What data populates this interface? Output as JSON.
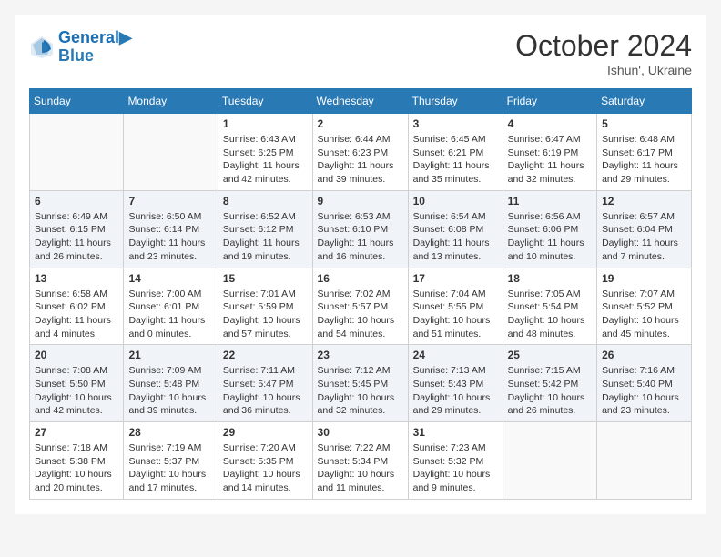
{
  "header": {
    "logo_line1": "General",
    "logo_line2": "Blue",
    "month": "October 2024",
    "location": "Ishun', Ukraine"
  },
  "weekdays": [
    "Sunday",
    "Monday",
    "Tuesday",
    "Wednesday",
    "Thursday",
    "Friday",
    "Saturday"
  ],
  "weeks": [
    [
      {
        "day": "",
        "info": ""
      },
      {
        "day": "",
        "info": ""
      },
      {
        "day": "1",
        "info": "Sunrise: 6:43 AM\nSunset: 6:25 PM\nDaylight: 11 hours and 42 minutes."
      },
      {
        "day": "2",
        "info": "Sunrise: 6:44 AM\nSunset: 6:23 PM\nDaylight: 11 hours and 39 minutes."
      },
      {
        "day": "3",
        "info": "Sunrise: 6:45 AM\nSunset: 6:21 PM\nDaylight: 11 hours and 35 minutes."
      },
      {
        "day": "4",
        "info": "Sunrise: 6:47 AM\nSunset: 6:19 PM\nDaylight: 11 hours and 32 minutes."
      },
      {
        "day": "5",
        "info": "Sunrise: 6:48 AM\nSunset: 6:17 PM\nDaylight: 11 hours and 29 minutes."
      }
    ],
    [
      {
        "day": "6",
        "info": "Sunrise: 6:49 AM\nSunset: 6:15 PM\nDaylight: 11 hours and 26 minutes."
      },
      {
        "day": "7",
        "info": "Sunrise: 6:50 AM\nSunset: 6:14 PM\nDaylight: 11 hours and 23 minutes."
      },
      {
        "day": "8",
        "info": "Sunrise: 6:52 AM\nSunset: 6:12 PM\nDaylight: 11 hours and 19 minutes."
      },
      {
        "day": "9",
        "info": "Sunrise: 6:53 AM\nSunset: 6:10 PM\nDaylight: 11 hours and 16 minutes."
      },
      {
        "day": "10",
        "info": "Sunrise: 6:54 AM\nSunset: 6:08 PM\nDaylight: 11 hours and 13 minutes."
      },
      {
        "day": "11",
        "info": "Sunrise: 6:56 AM\nSunset: 6:06 PM\nDaylight: 11 hours and 10 minutes."
      },
      {
        "day": "12",
        "info": "Sunrise: 6:57 AM\nSunset: 6:04 PM\nDaylight: 11 hours and 7 minutes."
      }
    ],
    [
      {
        "day": "13",
        "info": "Sunrise: 6:58 AM\nSunset: 6:02 PM\nDaylight: 11 hours and 4 minutes."
      },
      {
        "day": "14",
        "info": "Sunrise: 7:00 AM\nSunset: 6:01 PM\nDaylight: 11 hours and 0 minutes."
      },
      {
        "day": "15",
        "info": "Sunrise: 7:01 AM\nSunset: 5:59 PM\nDaylight: 10 hours and 57 minutes."
      },
      {
        "day": "16",
        "info": "Sunrise: 7:02 AM\nSunset: 5:57 PM\nDaylight: 10 hours and 54 minutes."
      },
      {
        "day": "17",
        "info": "Sunrise: 7:04 AM\nSunset: 5:55 PM\nDaylight: 10 hours and 51 minutes."
      },
      {
        "day": "18",
        "info": "Sunrise: 7:05 AM\nSunset: 5:54 PM\nDaylight: 10 hours and 48 minutes."
      },
      {
        "day": "19",
        "info": "Sunrise: 7:07 AM\nSunset: 5:52 PM\nDaylight: 10 hours and 45 minutes."
      }
    ],
    [
      {
        "day": "20",
        "info": "Sunrise: 7:08 AM\nSunset: 5:50 PM\nDaylight: 10 hours and 42 minutes."
      },
      {
        "day": "21",
        "info": "Sunrise: 7:09 AM\nSunset: 5:48 PM\nDaylight: 10 hours and 39 minutes."
      },
      {
        "day": "22",
        "info": "Sunrise: 7:11 AM\nSunset: 5:47 PM\nDaylight: 10 hours and 36 minutes."
      },
      {
        "day": "23",
        "info": "Sunrise: 7:12 AM\nSunset: 5:45 PM\nDaylight: 10 hours and 32 minutes."
      },
      {
        "day": "24",
        "info": "Sunrise: 7:13 AM\nSunset: 5:43 PM\nDaylight: 10 hours and 29 minutes."
      },
      {
        "day": "25",
        "info": "Sunrise: 7:15 AM\nSunset: 5:42 PM\nDaylight: 10 hours and 26 minutes."
      },
      {
        "day": "26",
        "info": "Sunrise: 7:16 AM\nSunset: 5:40 PM\nDaylight: 10 hours and 23 minutes."
      }
    ],
    [
      {
        "day": "27",
        "info": "Sunrise: 7:18 AM\nSunset: 5:38 PM\nDaylight: 10 hours and 20 minutes."
      },
      {
        "day": "28",
        "info": "Sunrise: 7:19 AM\nSunset: 5:37 PM\nDaylight: 10 hours and 17 minutes."
      },
      {
        "day": "29",
        "info": "Sunrise: 7:20 AM\nSunset: 5:35 PM\nDaylight: 10 hours and 14 minutes."
      },
      {
        "day": "30",
        "info": "Sunrise: 7:22 AM\nSunset: 5:34 PM\nDaylight: 10 hours and 11 minutes."
      },
      {
        "day": "31",
        "info": "Sunrise: 7:23 AM\nSunset: 5:32 PM\nDaylight: 10 hours and 9 minutes."
      },
      {
        "day": "",
        "info": ""
      },
      {
        "day": "",
        "info": ""
      }
    ]
  ]
}
